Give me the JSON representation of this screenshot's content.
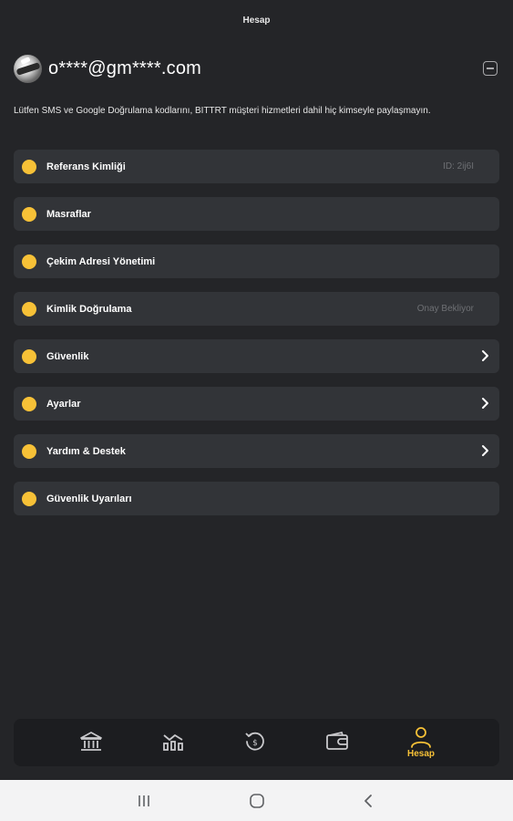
{
  "header": {
    "title": "Hesap"
  },
  "profile": {
    "email": "o****@gm****.com"
  },
  "notice": "Lütfen SMS ve Google Doğrulama kodlarını, BITTRT müşteri hizmetleri dahil hiç kimseyle paylaşmayın.",
  "colors": {
    "background": "#242528",
    "card": "#323438",
    "accent": "#f7c137",
    "muted_text": "#6e7074",
    "nav_background": "#1c1d20"
  },
  "menu": {
    "items": [
      {
        "label": "Referans Kimliği",
        "value": "ID: 2ij6I"
      },
      {
        "label": "Masraflar",
        "value": ""
      },
      {
        "label": "Çekim Adresi Yönetimi",
        "value": ""
      },
      {
        "label": "Kimlik Doğrulama",
        "value": "Onay Bekliyor"
      },
      {
        "label": "Güvenlik",
        "value": ""
      },
      {
        "label": "Ayarlar",
        "value": ""
      },
      {
        "label": "Yardım & Destek",
        "value": ""
      },
      {
        "label": "Güvenlik Uyarıları",
        "value": ""
      }
    ]
  },
  "bottom_nav": {
    "items": [
      {
        "icon": "bank-icon",
        "label": ""
      },
      {
        "icon": "market-chart-icon",
        "label": ""
      },
      {
        "icon": "history-icon",
        "label": ""
      },
      {
        "icon": "wallet-icon",
        "label": ""
      },
      {
        "icon": "person-icon",
        "label": "Hesap"
      }
    ],
    "active_index": 4
  },
  "system_nav": {
    "icons": [
      "recent-apps-icon",
      "home-icon",
      "back-icon"
    ]
  }
}
